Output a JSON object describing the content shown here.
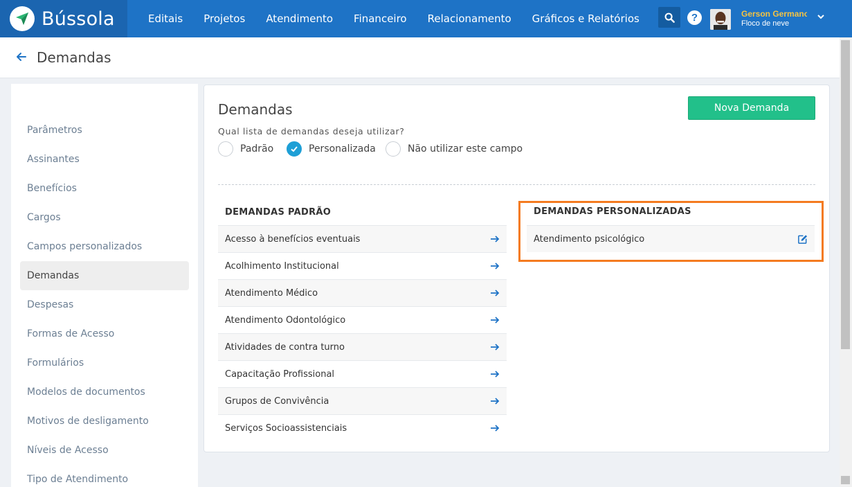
{
  "app": {
    "brand_name": "Bússola",
    "nav": [
      "Editais",
      "Projetos",
      "Atendimento",
      "Financeiro",
      "Relacionamento",
      "Gráficos e Relatórios"
    ],
    "user_name": "Gerson Germano",
    "user_sub": "Floco de neve"
  },
  "header": {
    "title": "Demandas"
  },
  "sidebar": {
    "items": [
      {
        "label": "Parâmetros"
      },
      {
        "label": "Assinantes"
      },
      {
        "label": "Benefícios"
      },
      {
        "label": "Cargos"
      },
      {
        "label": "Campos personalizados"
      },
      {
        "label": "Demandas",
        "active": true
      },
      {
        "label": "Despesas"
      },
      {
        "label": "Formas de Acesso"
      },
      {
        "label": "Formulários"
      },
      {
        "label": "Modelos de documentos"
      },
      {
        "label": "Motivos de desligamento"
      },
      {
        "label": "Níveis de Acesso"
      },
      {
        "label": "Tipo de Atendimento"
      }
    ]
  },
  "main": {
    "title": "Demandas",
    "new_button": "Nova Demanda",
    "question": "Qual lista de demandas deseja utilizar?",
    "options": [
      {
        "label": "Padrão",
        "checked": false
      },
      {
        "label": "Personalizada",
        "checked": true
      },
      {
        "label": "Não utilizar este campo",
        "checked": false
      }
    ],
    "default_title": "DEMANDAS PADRÃO",
    "default_items": [
      "Acesso à benefícios eventuais",
      "Acolhimento Institucional",
      "Atendimento Médico",
      "Atendimento Odontológico",
      "Atividades de contra turno",
      "Capacitação Profissional",
      "Grupos de Convivência",
      "Serviços Socioassistenciais"
    ],
    "custom_title": "DEMANDAS PERSONALIZADAS",
    "custom_items": [
      "Atendimento psicológico"
    ]
  },
  "colors": {
    "nav_bg": "#1e73c6",
    "accent_green": "#22c08a",
    "highlight": "#f47b20",
    "radio_checked": "#1e9fd6"
  },
  "icons": {
    "back": "arrow-left-icon",
    "row_action": "arrow-right-icon",
    "edit": "edit-icon",
    "search": "search-icon",
    "help": "help-icon"
  }
}
